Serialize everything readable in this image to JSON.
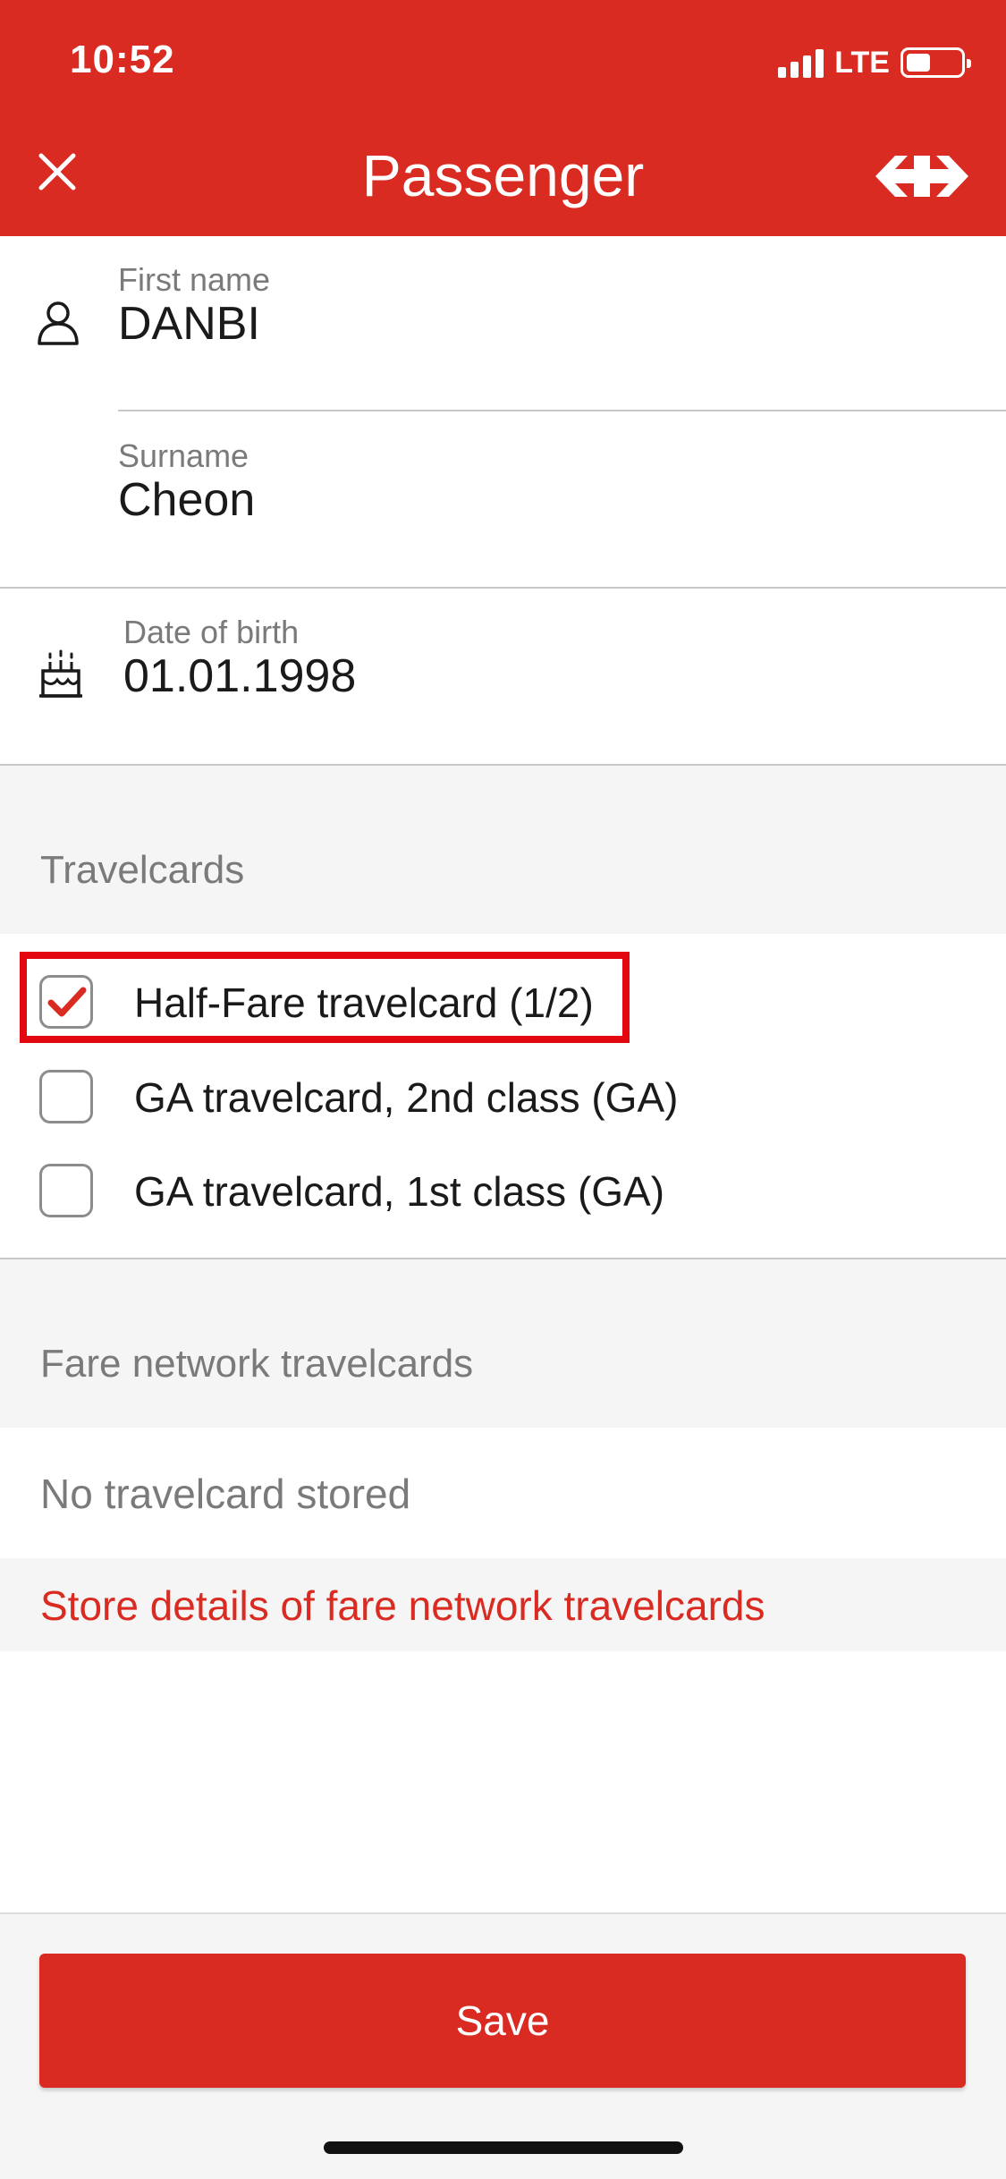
{
  "status_bar": {
    "time": "10:52",
    "network": "LTE",
    "battery_level_percent": 45,
    "signal_bars": 4
  },
  "header": {
    "title": "Passenger",
    "close_icon": "close-icon",
    "logo_icon": "sbb-logo-icon",
    "color": "#d92b21"
  },
  "passenger": {
    "first_name_label": "First name",
    "first_name": "DANBI",
    "surname_label": "Surname",
    "surname": "Cheon",
    "dob_label": "Date of birth",
    "dob": "01.01.1998",
    "person_icon": "person-icon",
    "birthday_icon": "birthday-cake-icon"
  },
  "travelcards": {
    "section_title": "Travelcards",
    "items": [
      {
        "label": "Half-Fare travelcard (1/2)",
        "checked": true
      },
      {
        "label": "GA travelcard, 2nd class (GA)",
        "checked": false
      },
      {
        "label": "GA travelcard, 1st class (GA)",
        "checked": false
      }
    ],
    "highlighted_item": "Half-Fare travelcard (1/2)",
    "highlight_color": "#e3070f"
  },
  "fare_network": {
    "section_title": "Fare network travelcards",
    "empty_text": "No travelcard stored",
    "store_link": "Store details of fare network travelcards"
  },
  "footer": {
    "save_label": "Save"
  }
}
